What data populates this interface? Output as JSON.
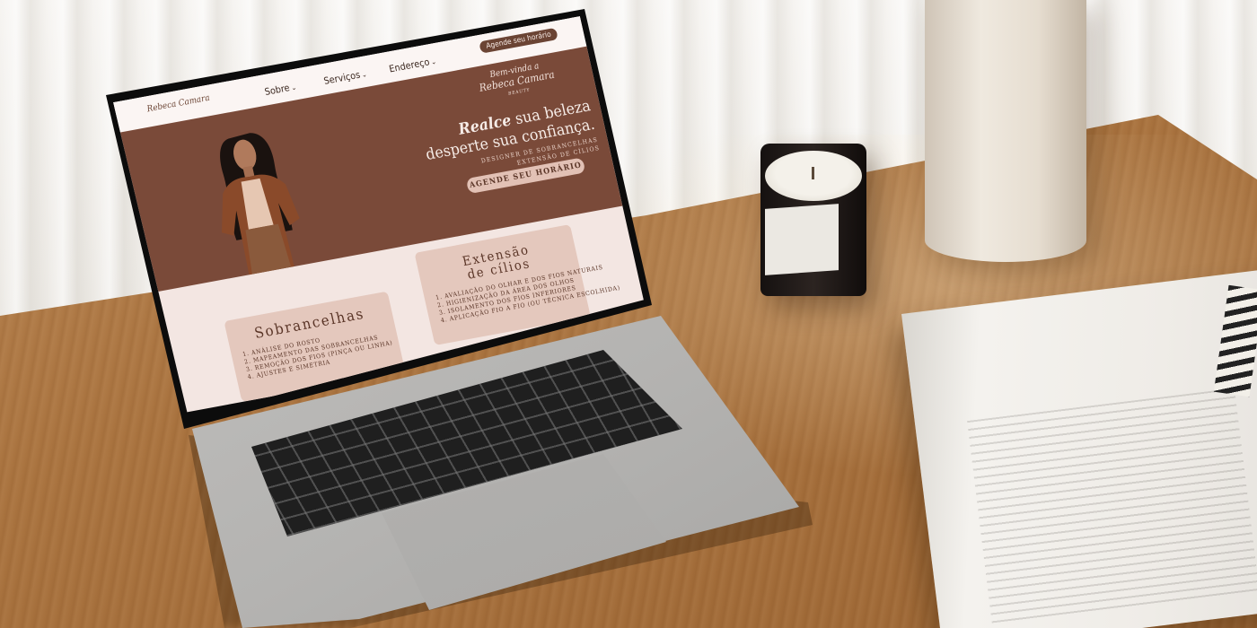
{
  "scene": {
    "candle_label": "",
    "book_text": ""
  },
  "site": {
    "logo": "Rebeca Camara",
    "nav": {
      "sobre": "Sobre",
      "servicos": "Serviços",
      "endereco": "Endereço",
      "cta": "Agende seu horário",
      "chevron": "⌄"
    },
    "welcome": {
      "line1": "Bem-vinda a",
      "line2": "Rebeca Camara",
      "line3": "BEAUTY"
    },
    "hero": {
      "headline_bold": "Realce",
      "headline_rest": " sua beleza",
      "headline_line2": "desperte sua confiança.",
      "subtitle_line1": "Designer de sobrancelhas",
      "subtitle_line2": "Extensão de cílios",
      "cta": "Agende seu horário"
    },
    "cards": {
      "sobrancelhas": {
        "title": "Sobrancelhas",
        "items": [
          "1. Análise do rosto",
          "2. Mapeamento das sobrancelhas",
          "3. Remoção dos fios (pinça ou linha)",
          "4. Ajustes e simetria"
        ]
      },
      "cilios": {
        "title_line1": "Extensão",
        "title_line2": "de cílios",
        "items": [
          "1. Avaliação do olhar e dos fios naturais",
          "2. Higienização da área dos olhos",
          "3. Isolamento dos fios inferiores",
          "4. Aplicação fio a fio (ou técnica escolhida)"
        ]
      }
    }
  }
}
